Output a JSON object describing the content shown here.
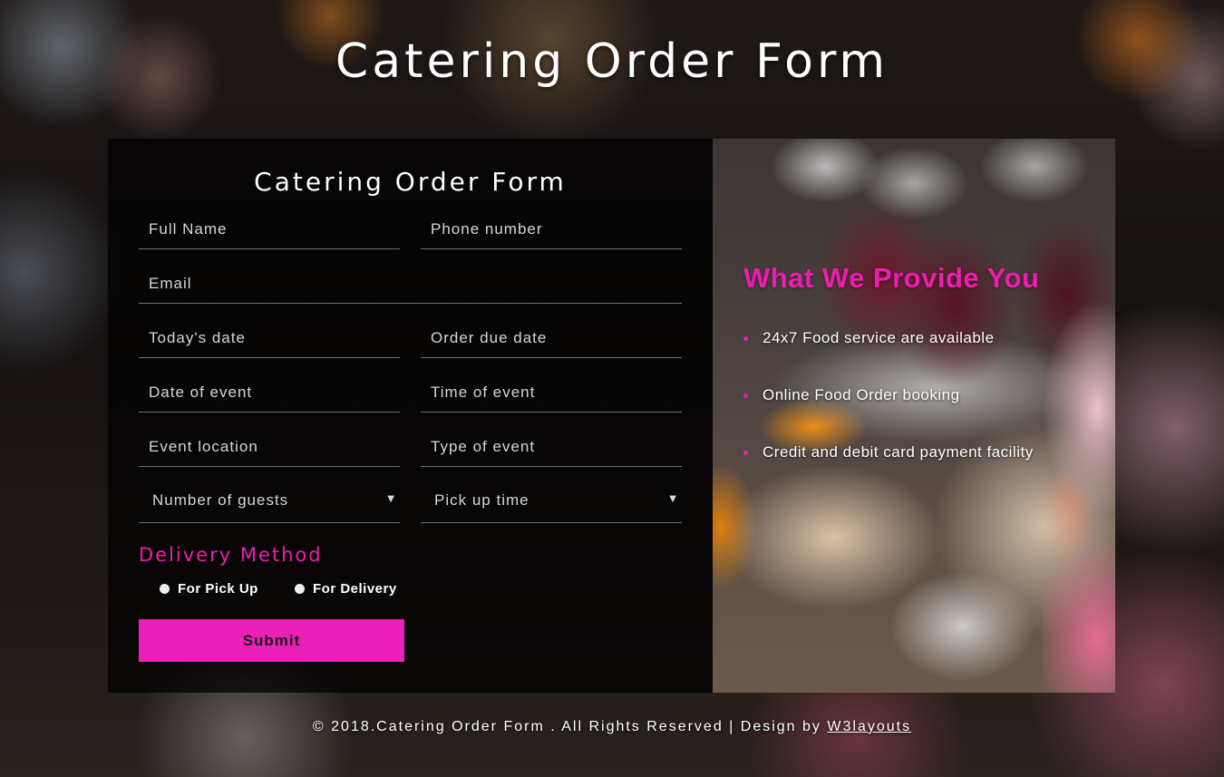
{
  "page": {
    "title": "Catering Order Form"
  },
  "form": {
    "title": "Catering Order Form",
    "fields": {
      "full_name": "Full Name",
      "phone_number": "Phone number",
      "email": "Email",
      "todays_date": "Today's date",
      "order_due_date": "Order due date",
      "date_of_event": "Date of event",
      "time_of_event": "Time of event",
      "event_location": "Event location",
      "type_of_event": "Type of event"
    },
    "selects": {
      "number_of_guests": "Number of guests",
      "pick_up_time": "Pick up time"
    },
    "delivery": {
      "heading": "Delivery Method",
      "options": [
        "For Pick Up",
        "For Delivery"
      ]
    },
    "submit_label": "Submit"
  },
  "info": {
    "title": "What We Provide You",
    "items": [
      "24x7 Food service are available",
      "Online Food Order booking",
      "Credit and debit card payment facility"
    ]
  },
  "footer": {
    "text": "© 2018.Catering Order Form . All Rights Reserved | Design by",
    "link": "W3layouts"
  },
  "colors": {
    "accent": "#ec1fb6",
    "panel_bg": "#000000"
  },
  "icons": {
    "select_caret": "caret-down-icon",
    "list_bullet": "bullet-icon",
    "radio": "radio-icon"
  }
}
